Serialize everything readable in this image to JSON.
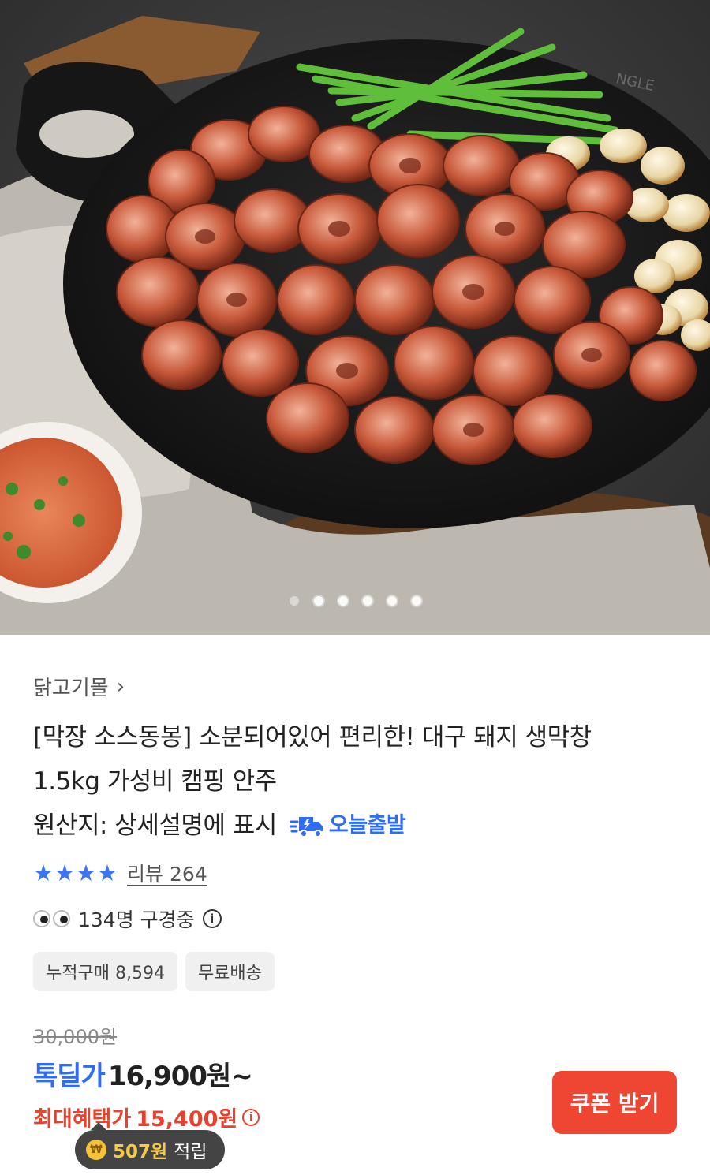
{
  "hero": {
    "image_alt": "grilled pork intestines on a cast iron pan",
    "pan_brand": "NGLE",
    "carousel_dots": 6,
    "active_dot": 0
  },
  "product": {
    "store_name": "닭고기몰",
    "title_line1": "[막장 소스동봉] 소분되어있어 편리한! 대구 돼지 생막창",
    "title_line2": "1.5kg 가성비 캠핑 안주",
    "origin": "원산지: 상세설명에 표시",
    "delivery_badge": "오늘출발",
    "rating_stars": 4,
    "review_label": "리뷰 264",
    "viewers_text": "134명 구경중",
    "chips": [
      "누적구매 8,594",
      "무료배송"
    ]
  },
  "price": {
    "original": "30,000원",
    "deal_label": "톡딜가",
    "deal_price": "16,900원~",
    "max_label": "최대혜택가",
    "max_price": "15,400원"
  },
  "actions": {
    "coupon_button": "쿠폰 받기"
  },
  "points": {
    "amount": "507원",
    "suffix": "적립",
    "coin_symbol": "₩"
  },
  "colors": {
    "accent_blue": "#2e6cf6",
    "accent_red": "#e8412c",
    "coupon_bg": "#ee4632"
  }
}
